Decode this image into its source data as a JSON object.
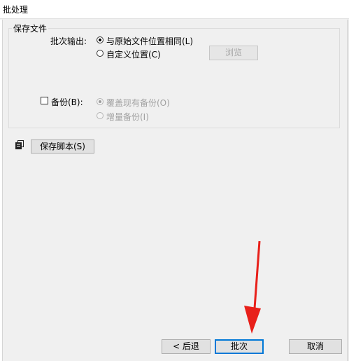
{
  "window": {
    "title": "批处理"
  },
  "save_file": {
    "group_title": "保存文件",
    "batch_output_label": "批次输出:",
    "options": [
      {
        "label": "与原始文件位置相同(L)",
        "selected": true
      },
      {
        "label": "自定义位置(C)",
        "selected": false
      }
    ],
    "browse_button": "浏览",
    "backup": {
      "checkbox_label": "备份(B):",
      "checked": false,
      "options": [
        {
          "label": "覆盖现有备份(O)",
          "selected": true
        },
        {
          "label": "增量备份(I)",
          "selected": false
        }
      ]
    }
  },
  "script": {
    "icon": "script-copy-icon",
    "save_button": "保存脚本(S)"
  },
  "footer": {
    "back_button": "< 后退",
    "batch_button": "批次",
    "cancel_button": "取消"
  },
  "annotation": {
    "arrow_color": "#e8201a"
  }
}
